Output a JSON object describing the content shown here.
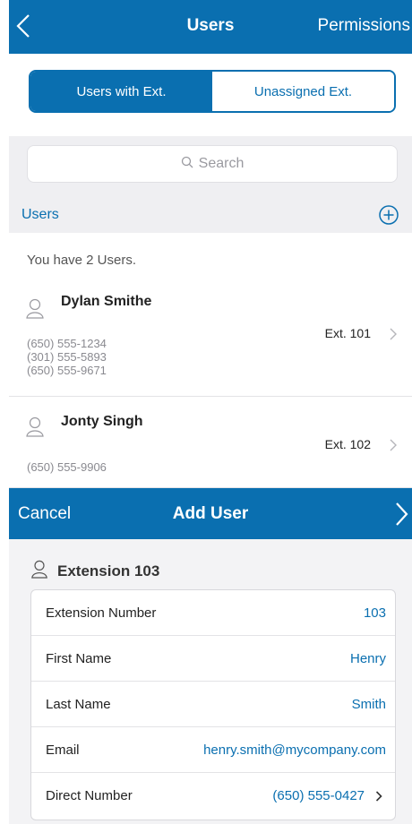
{
  "topbar": {
    "title": "Users",
    "right_label": "Permissions"
  },
  "segment": {
    "left": "Users with Ext.",
    "right": "Unassigned Ext."
  },
  "search": {
    "placeholder": "Search"
  },
  "users_section": {
    "label": "Users",
    "count_text": "You have 2 Users."
  },
  "users": [
    {
      "name": "Dylan Smithe",
      "ext": "Ext. 101",
      "phones": [
        "(650) 555-1234",
        "(301) 555-5893",
        "(650) 555-9671"
      ]
    },
    {
      "name": "Jonty Singh",
      "ext": "Ext. 102",
      "phones": [
        "(650) 555-9906"
      ]
    }
  ],
  "add_user": {
    "cancel_label": "Cancel",
    "title": "Add User",
    "extension_heading": "Extension 103",
    "fields": [
      {
        "label": "Extension Number",
        "value": "103"
      },
      {
        "label": "First Name",
        "value": "Henry"
      },
      {
        "label": "Last Name",
        "value": "Smith"
      },
      {
        "label": "Email",
        "value": "henry.smith@mycompany.com"
      },
      {
        "label": "Direct Number",
        "value": "(650) 555-0427"
      }
    ]
  },
  "colors": {
    "accent": "#0a6fb0",
    "section_bg": "#efeff2"
  },
  "icons": [
    "back-chevron-icon",
    "search-icon",
    "add-circle-icon",
    "user-icon",
    "chevron-right-icon",
    "next-chevron-icon"
  ]
}
